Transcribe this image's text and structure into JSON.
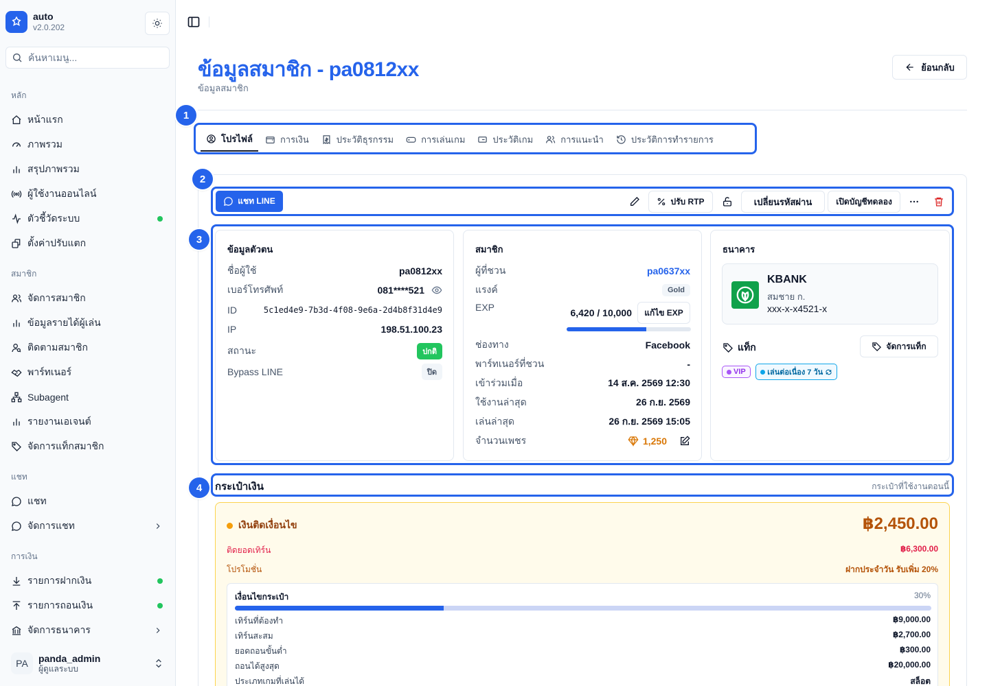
{
  "app": {
    "name": "auto",
    "version": "v2.0.202"
  },
  "search": {
    "placeholder": "ค้นหาเมนู..."
  },
  "sidebar": {
    "groups": [
      {
        "label": "หลัก",
        "items": [
          {
            "label": "หน้าแรก",
            "icon": "home-icon"
          },
          {
            "label": "ภาพรวม",
            "icon": "gauge-icon"
          },
          {
            "label": "สรุปภาพรวม",
            "icon": "bar-chart-icon"
          },
          {
            "label": "ผู้ใช้งานออนไลน์",
            "icon": "radio-icon"
          },
          {
            "label": "ตัวชี้วัดระบบ",
            "icon": "activity-icon",
            "dot": true
          },
          {
            "label": "ตั้งค่าปรับแตก",
            "icon": "settings-icon"
          }
        ]
      },
      {
        "label": "สมาชิก",
        "items": [
          {
            "label": "จัดการสมาชิก",
            "icon": "users-icon"
          },
          {
            "label": "ข้อมูลรายได้ผู้เล่น",
            "icon": "bar-chart-icon"
          },
          {
            "label": "ติดตามสมาชิก",
            "icon": "user-search-icon"
          },
          {
            "label": "พาร์ทเนอร์",
            "icon": "handshake-icon"
          },
          {
            "label": "Subagent",
            "icon": "network-icon"
          },
          {
            "label": "รายงานเอเจนต์",
            "icon": "bar-chart-icon"
          },
          {
            "label": "จัดการแท็กสมาชิก",
            "icon": "tag-icon"
          }
        ]
      },
      {
        "label": "แชท",
        "items": [
          {
            "label": "แชท",
            "icon": "chat-icon"
          },
          {
            "label": "จัดการแชท",
            "icon": "chat-icon",
            "chevron": true
          }
        ]
      },
      {
        "label": "การเงิน",
        "items": [
          {
            "label": "รายการฝากเงิน",
            "icon": "download-icon",
            "dot": true
          },
          {
            "label": "รายการถอนเงิน",
            "icon": "upload-icon",
            "dot": true
          },
          {
            "label": "จัดการธนาคาร",
            "icon": "bank-icon",
            "chevron": true
          }
        ]
      }
    ]
  },
  "user": {
    "initials": "PA",
    "name": "panda_admin",
    "role": "ผู้ดูแลระบบ"
  },
  "page": {
    "title": "ข้อมูลสมาชิก - pa0812xx",
    "subtitle": "ข้อมูลสมาชิก",
    "back_label": "ย้อนกลับ"
  },
  "annotations": [
    "1",
    "2",
    "3",
    "4"
  ],
  "tabs": [
    "โปรไฟล์",
    "การเงิน",
    "ประวัติธุรกรรม",
    "การเล่นเกม",
    "ประวัติเกม",
    "การแนะนำ",
    "ประวัติการทำรายการ"
  ],
  "toolbar": {
    "line_chat": "แชท LINE",
    "adjust_rtp": "ปรับ RTP",
    "change_password": "เปลี่ยนรหัสผ่าน",
    "open_demo": "เปิดบัญชีทดลอง"
  },
  "identity": {
    "title": "ข้อมูลตัวตน",
    "username_label": "ชื่อผู้ใช้",
    "username": "pa0812xx",
    "phone_label": "เบอร์โทรศัพท์",
    "phone": "081****521",
    "id_label": "ID",
    "id": "5c1ed4e9-7b3d-4f08-9e6a-2d4b8f31d4e9",
    "ip_label": "IP",
    "ip": "198.51.100.23",
    "status_label": "สถานะ",
    "status": "ปกติ",
    "bypass_label": "Bypass LINE",
    "bypass": "ปิด"
  },
  "member": {
    "title": "สมาชิก",
    "referrer_label": "ผู้ที่ชวน",
    "referrer": "pa0637xx",
    "rank_label": "แรงค์",
    "rank": "Gold",
    "exp_label": "EXP",
    "exp": "6,420 / 10,000",
    "exp_progress": 0.642,
    "edit_exp": "แก้ไข EXP",
    "channel_label": "ช่องทาง",
    "channel": "Facebook",
    "partner_label": "พาร์ทเนอร์ที่ชวน",
    "partner": "-",
    "joined_label": "เข้าร่วมเมื่อ",
    "joined": "14 ส.ค. 2569 12:30",
    "last_active_label": "ใช้งานล่าสุด",
    "last_active": "26 ก.ย. 2569",
    "last_play_label": "เล่นล่าสุด",
    "last_play": "26 ก.ย. 2569 15:05",
    "diamonds_label": "จำนวนเพชร",
    "diamonds": "1,250"
  },
  "bank": {
    "title": "ธนาคาร",
    "name": "KBANK",
    "holder": "สมชาย ก.",
    "account": "xxx-x-x4521-x",
    "tags_label": "แท็ก",
    "manage_tags": "จัดการแท็ก",
    "tags": [
      {
        "label": "VIP",
        "color": "#a855f7"
      },
      {
        "label": "เล่นต่อเนื่อง 7 วัน",
        "color": "#0ea5e9"
      }
    ]
  },
  "wallet": {
    "title": "กระเป๋าเงิน",
    "subtitle": "กระเป๋าที่ใช้งานตอนนี้",
    "type": "เงินติดเงื่อนไข",
    "balance": "฿2,450.00",
    "turnover_label": "ติดยอดเทิร์น",
    "turnover": "฿6,300.00",
    "promo_label": "โปรโมชั่น",
    "promo": "ฝากประจำวัน รับเพิ่ม 20%",
    "condition_label": "เงื่อนไขกระเป๋า",
    "condition_pct": "30%",
    "condition_progress": 0.3,
    "rows": [
      {
        "label": "เทิร์นที่ต้องทำ",
        "value": "฿9,000.00"
      },
      {
        "label": "เทิร์นสะสม",
        "value": "฿2,700.00"
      },
      {
        "label": "ยอดถอนขั้นต่ำ",
        "value": "฿300.00"
      },
      {
        "label": "ถอนได้สูงสุด",
        "value": "฿20,000.00"
      },
      {
        "label": "ประเภทเกมที่เล่นได้",
        "value": "สล็อต"
      }
    ]
  },
  "colors": {
    "primary": "#2563eb",
    "success": "#22c55e",
    "warning": "#d97706",
    "danger": "#dc2626"
  }
}
